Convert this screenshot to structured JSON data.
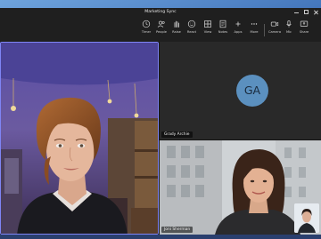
{
  "window": {
    "title": "Marketing Sync"
  },
  "toolbar": {
    "items": [
      {
        "icon": "clock-icon",
        "label": "Timer"
      },
      {
        "icon": "people-icon",
        "label": "People"
      },
      {
        "icon": "raise-hand-icon",
        "label": "Raise"
      },
      {
        "icon": "smiley-icon",
        "label": "React"
      },
      {
        "icon": "grid-view-icon",
        "label": "View"
      },
      {
        "icon": "notes-icon",
        "label": "Notes"
      },
      {
        "icon": "apps-icon",
        "label": "Apps"
      },
      {
        "icon": "more-icon",
        "label": "More"
      },
      {
        "icon": "camera-icon",
        "label": "Camera"
      },
      {
        "icon": "mic-icon",
        "label": "Mic"
      },
      {
        "icon": "share-icon",
        "label": "Share"
      }
    ],
    "leave_color": "#c4314b"
  },
  "participants": {
    "main": {
      "name": "",
      "kind": "3d-avatar"
    },
    "ga": {
      "initials": "GA",
      "name": "Grady Archie",
      "avatar_color": "#5b90bf"
    },
    "joni": {
      "name": "Joni Sherman"
    },
    "self": {
      "kind": "self-view"
    }
  },
  "accent": "#7f85f5"
}
